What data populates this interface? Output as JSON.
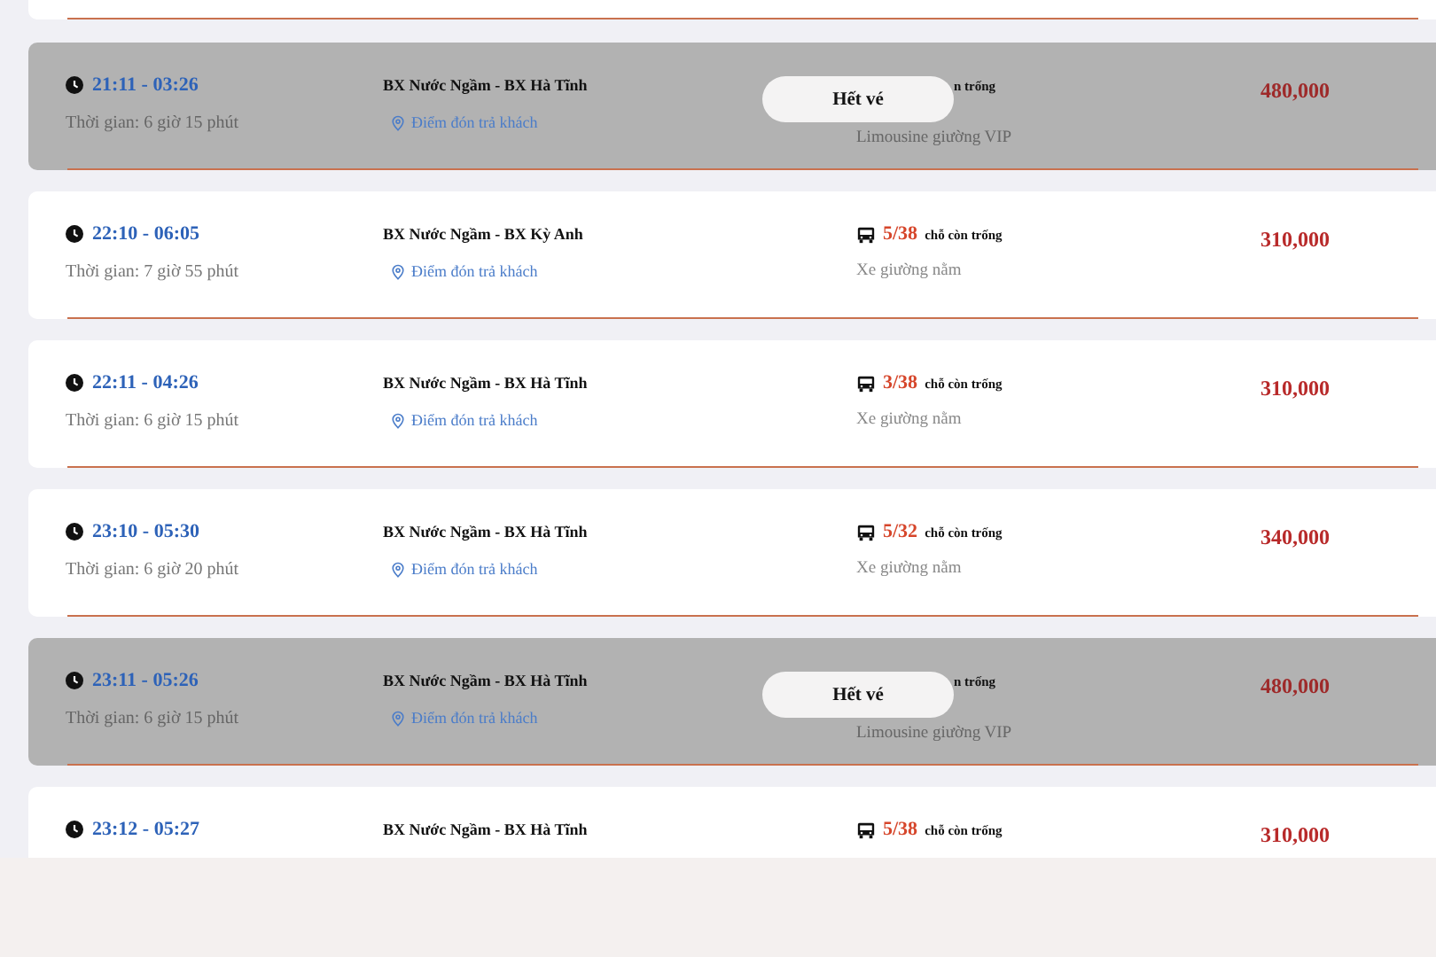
{
  "trips": [
    {
      "sold_out": true,
      "time": "21:11 - 03:26",
      "duration": "Thời gian: 6 giờ 15 phút",
      "route": "BX Nước Ngầm - BX Hà Tĩnh",
      "pickup": "Điểm đón trả khách",
      "sold_out_label": "Hết vé",
      "seats_label": "n trống",
      "vehicle": "Limousine giường VIP",
      "price": "480,000"
    },
    {
      "sold_out": false,
      "time": "22:10 - 06:05",
      "duration": "Thời gian: 7 giờ 55 phút",
      "route": "BX Nước Ngầm - BX Kỳ Anh",
      "pickup": "Điểm đón trả khách",
      "seats": "5/38",
      "seats_label": "chỗ còn trống",
      "vehicle": "Xe giường nằm",
      "price": "310,000"
    },
    {
      "sold_out": false,
      "time": "22:11 - 04:26",
      "duration": "Thời gian: 6 giờ 15 phút",
      "route": "BX Nước Ngầm - BX Hà Tĩnh",
      "pickup": "Điểm đón trả khách",
      "seats": "3/38",
      "seats_label": "chỗ còn trống",
      "vehicle": "Xe giường nằm",
      "price": "310,000"
    },
    {
      "sold_out": false,
      "time": "23:10 - 05:30",
      "duration": "Thời gian: 6 giờ 20 phút",
      "route": "BX Nước Ngầm - BX Hà Tĩnh",
      "pickup": "Điểm đón trả khách",
      "seats": "5/32",
      "seats_label": "chỗ còn trống",
      "vehicle": "Xe giường nằm",
      "price": "340,000"
    },
    {
      "sold_out": true,
      "time": "23:11 - 05:26",
      "duration": "Thời gian: 6 giờ 15 phút",
      "route": "BX Nước Ngầm - BX Hà Tĩnh",
      "pickup": "Điểm đón trả khách",
      "sold_out_label": "Hết vé",
      "seats_label": "n trống",
      "vehicle": "Limousine giường VIP",
      "price": "480,000"
    },
    {
      "sold_out": false,
      "time": "23:12 - 05:27",
      "route": "BX Nước Ngầm - BX Hà Tĩnh",
      "seats": "5/38",
      "seats_label": "chỗ còn trống",
      "price": "310,000"
    }
  ]
}
